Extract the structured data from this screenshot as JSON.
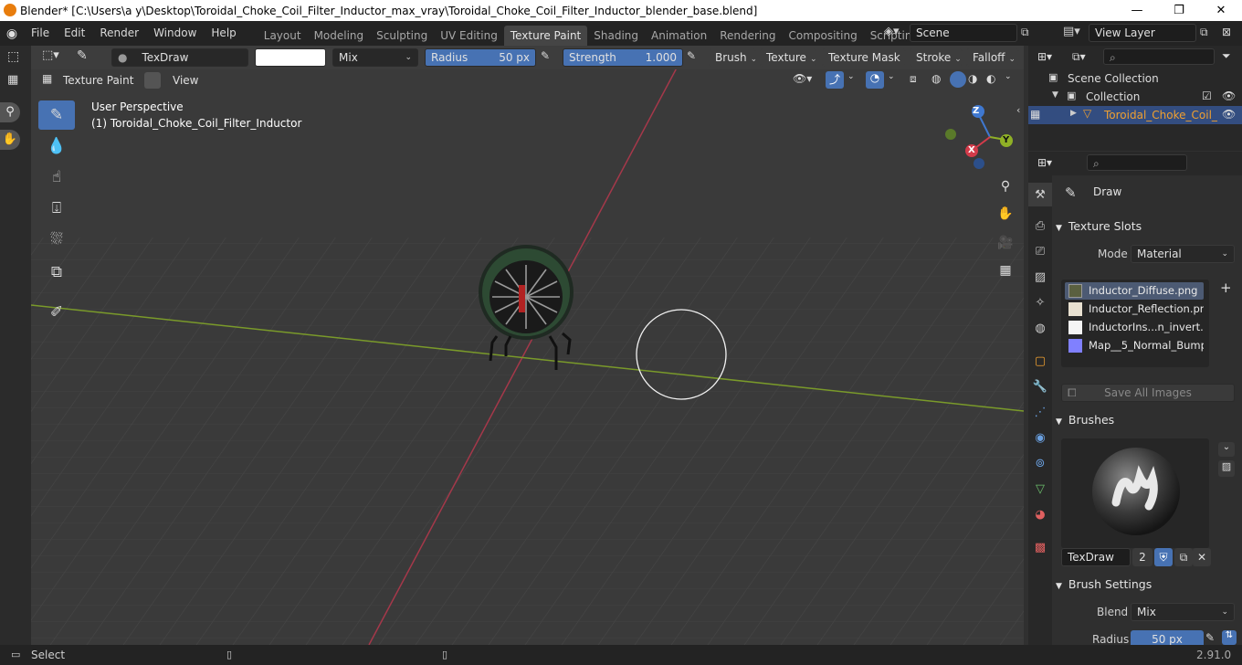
{
  "window": {
    "title": "Blender* [C:\\Users\\a y\\Desktop\\Toroidal_Choke_Coil_Filter_Inductor_max_vray\\Toroidal_Choke_Coil_Filter_Inductor_blender_base.blend]",
    "minimize": "—",
    "maximize": "❐",
    "close": "✕"
  },
  "menu": [
    "File",
    "Edit",
    "Render",
    "Window",
    "Help"
  ],
  "workspaces": [
    "Layout",
    "Modeling",
    "Sculpting",
    "UV Editing",
    "Texture Paint",
    "Shading",
    "Animation",
    "Rendering",
    "Compositing",
    "Scripting"
  ],
  "active_workspace": "Texture Paint",
  "add_workspace": "+",
  "scene": {
    "name": "Scene"
  },
  "view_layer": {
    "name": "View Layer"
  },
  "tool_settings": {
    "brush_name": "TexDraw",
    "blend_mode": "Mix",
    "radius_label": "Radius",
    "radius_value": "50 px",
    "strength_label": "Strength",
    "strength_value": "1.000",
    "brush": "Brush",
    "texture": "Texture",
    "texture_mask": "Texture Mask",
    "stroke": "Stroke",
    "falloff": "Falloff"
  },
  "view_header": {
    "mode": "Texture Paint",
    "view": "View"
  },
  "viewport": {
    "perspective": "User Perspective",
    "object_label": "(1) Toroidal_Choke_Coil_Filter_Inductor",
    "gizmo": {
      "z": "Z",
      "y": "Y",
      "x": "X"
    }
  },
  "outliner": {
    "scene_collection": "Scene Collection",
    "collection": "Collection",
    "object": "Toroidal_Choke_Coil_"
  },
  "properties": {
    "tool_name": "Draw",
    "texture_slots": {
      "header": "Texture Slots",
      "mode_label": "Mode",
      "mode_value": "Material",
      "add": "+",
      "slots": [
        "Inductor_Diffuse.png",
        "Inductor_Reflection.png",
        "InductorIns...n_invert.png",
        "Map__5_Normal_Bump...."
      ],
      "save_all": "Save All Images"
    },
    "brushes": {
      "header": "Brushes",
      "name": "TexDraw",
      "users": "2"
    },
    "brush_settings": {
      "header": "Brush Settings",
      "blend_label": "Blend",
      "blend_value": "Mix",
      "radius_label": "Radius",
      "radius_value": "50 px"
    }
  },
  "status": {
    "select": "Select",
    "version": "2.91.0"
  },
  "colors": {
    "accent": "#4772b3",
    "x_axis": "#d33b4a",
    "y_axis": "#8fb026",
    "z_axis": "#3f78d0",
    "active_object_text": "#f0a030"
  }
}
